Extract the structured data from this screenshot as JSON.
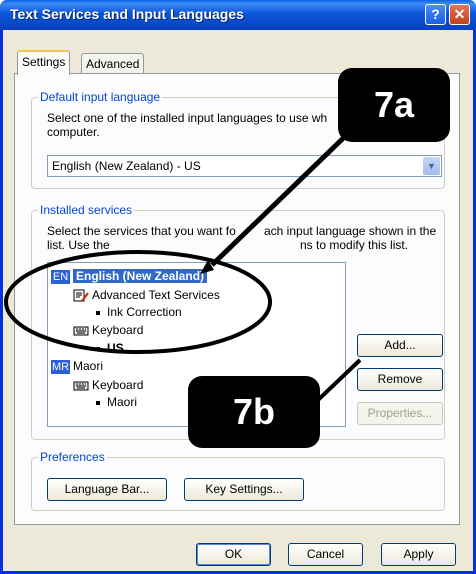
{
  "window": {
    "title": "Text Services and Input Languages",
    "help_label": "?",
    "close_label": "✕"
  },
  "tabs": [
    {
      "label": "Settings"
    },
    {
      "label": "Advanced"
    }
  ],
  "default_input": {
    "legend": "Default input language",
    "description_line1": "Select one of the installed input languages to use wh",
    "description_line2": "computer.",
    "selected": "English (New Zealand) - US"
  },
  "installed_services": {
    "legend": "Installed services",
    "description_line1": "Select the services that you want fo",
    "description_line1_end": "ach input language shown in the",
    "description_line2_start": "list. Use the",
    "description_line2_end": "ns to modify this list.",
    "tree": [
      {
        "badge": "EN",
        "label": "English (New Zealand)"
      },
      {
        "label": "Advanced Text Services"
      },
      {
        "label": "Ink Correction"
      },
      {
        "label": "Keyboard"
      },
      {
        "label": "US"
      },
      {
        "badge": "MR",
        "label": "Maori"
      },
      {
        "label": "Keyboard"
      },
      {
        "label": "Maori"
      }
    ],
    "buttons": {
      "add": "Add...",
      "remove": "Remove",
      "properties": "Properties..."
    }
  },
  "preferences": {
    "legend": "Preferences",
    "language_bar": "Language Bar...",
    "key_settings": "Key Settings..."
  },
  "footer": {
    "ok": "OK",
    "cancel": "Cancel",
    "apply": "Apply"
  },
  "annotations": {
    "callout_a": "7a",
    "callout_b": "7b"
  },
  "colors": {
    "title_blue": "#0a49c9",
    "selection": "#316ac5",
    "legend_text": "#0046d5",
    "window_bg": "#ece9d8"
  }
}
